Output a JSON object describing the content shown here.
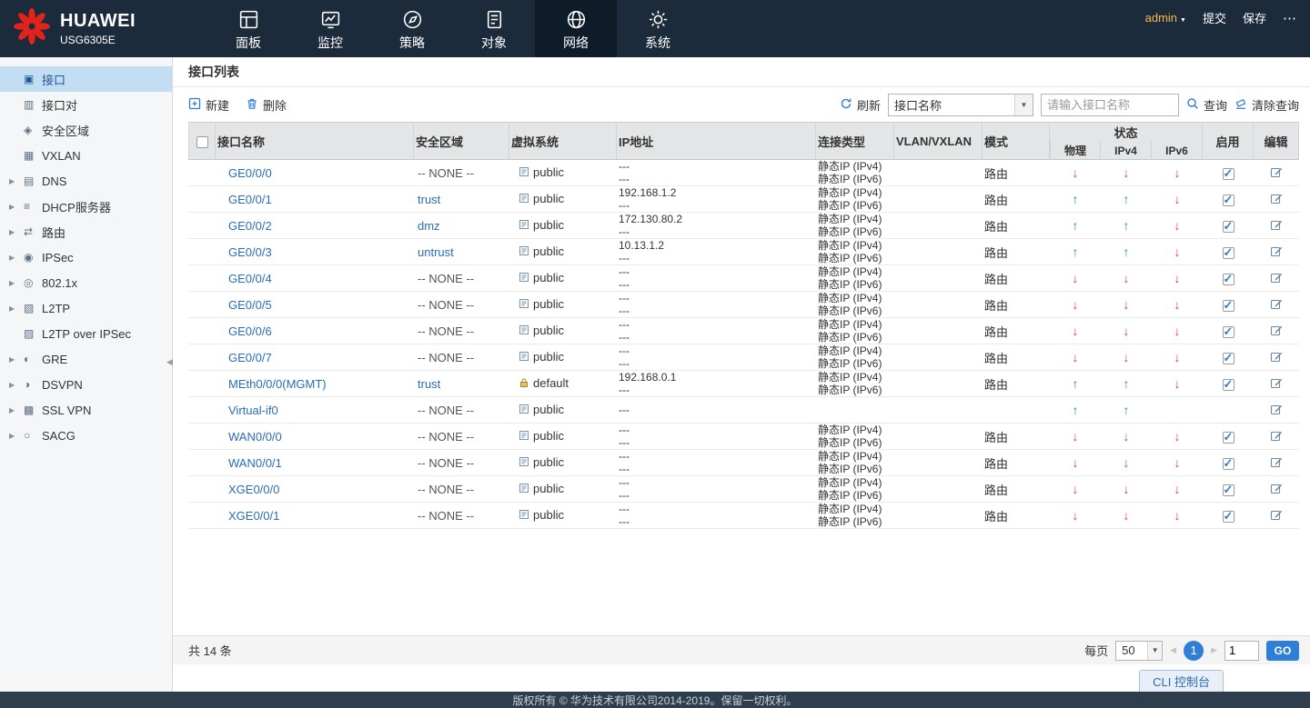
{
  "colors": {
    "accent": "#2f7ed8",
    "brand_red": "#e2231a",
    "status_up": "#2ca24c",
    "status_down": "#e04444",
    "topbar_bg": "#1c2b3c",
    "sidebar_selected_bg": "#c3ddf3"
  },
  "app": {
    "brand": "HUAWEI",
    "model": "USG6305E",
    "user": "admin",
    "actions": {
      "commit": "提交",
      "save": "保存",
      "more": "⋯"
    }
  },
  "nav": [
    {
      "id": "dashboard",
      "label": "面板",
      "icon": "dashboard-icon",
      "active": false
    },
    {
      "id": "monitor",
      "label": "监控",
      "icon": "monitor-icon",
      "active": false
    },
    {
      "id": "policy",
      "label": "策略",
      "icon": "policy-icon",
      "active": false
    },
    {
      "id": "object",
      "label": "对象",
      "icon": "object-icon",
      "active": false
    },
    {
      "id": "network",
      "label": "网络",
      "icon": "network-icon",
      "active": true
    },
    {
      "id": "system",
      "label": "系统",
      "icon": "system-icon",
      "active": false
    }
  ],
  "sidebar": [
    {
      "id": "interface",
      "label": "接口",
      "icon": "interface-icon",
      "active": true,
      "expandable": false
    },
    {
      "id": "interface-pair",
      "label": "接口对",
      "icon": "interface-pair-icon",
      "active": false,
      "expandable": false
    },
    {
      "id": "security-zone",
      "label": "安全区域",
      "icon": "security-zone-icon",
      "active": false,
      "expandable": false
    },
    {
      "id": "vxlan",
      "label": "VXLAN",
      "icon": "vxlan-icon",
      "active": false,
      "expandable": false
    },
    {
      "id": "dns",
      "label": "DNS",
      "icon": "dns-icon",
      "active": false,
      "expandable": true
    },
    {
      "id": "dhcp-server",
      "label": "DHCP服务器",
      "icon": "dhcp-icon",
      "active": false,
      "expandable": true
    },
    {
      "id": "route",
      "label": "路由",
      "icon": "route-icon",
      "active": false,
      "expandable": true
    },
    {
      "id": "ipsec",
      "label": "IPSec",
      "icon": "ipsec-icon",
      "active": false,
      "expandable": true
    },
    {
      "id": "dot1x",
      "label": "802.1x",
      "icon": "dot1x-icon",
      "active": false,
      "expandable": true
    },
    {
      "id": "l2tp",
      "label": "L2TP",
      "icon": "l2tp-icon",
      "active": false,
      "expandable": true
    },
    {
      "id": "l2tp-over-ipsec",
      "label": "L2TP over IPSec",
      "icon": "l2tp-ipsec-icon",
      "active": false,
      "expandable": false
    },
    {
      "id": "gre",
      "label": "GRE",
      "icon": "gre-icon",
      "active": false,
      "expandable": true
    },
    {
      "id": "dsvpn",
      "label": "DSVPN",
      "icon": "dsvpn-icon",
      "active": false,
      "expandable": true
    },
    {
      "id": "ssl-vpn",
      "label": "SSL VPN",
      "icon": "sslvpn-icon",
      "active": false,
      "expandable": true
    },
    {
      "id": "sacg",
      "label": "SACG",
      "icon": "sacg-icon",
      "active": false,
      "expandable": true
    }
  ],
  "page": {
    "title": "接口列表",
    "toolbar": {
      "new": "新建",
      "delete": "删除",
      "refresh": "刷新",
      "filter_selected": "接口名称",
      "search_placeholder": "请输入接口名称",
      "query": "查询",
      "clear_query": "清除查询"
    },
    "table": {
      "headers": {
        "name": "接口名称",
        "zone": "安全区域",
        "vsys": "虚拟系统",
        "ip": "IP地址",
        "conn": "连接类型",
        "vlan": "VLAN/VXLAN",
        "mode": "模式",
        "status": "状态",
        "phy": "物理",
        "ipv4": "IPv4",
        "ipv6": "IPv6",
        "enable": "启用",
        "edit": "编辑"
      },
      "rows": [
        {
          "name": "GE0/0/0",
          "zone": "-- NONE --",
          "zone_is_link": false,
          "vsys": "public",
          "vsys_icon": "vsys-doc-icon",
          "ip": [
            "---",
            "---"
          ],
          "conn": [
            "静态IP (IPv4)",
            "静态IP (IPv6)"
          ],
          "vlan": "",
          "mode": "路由",
          "status": {
            "phy": "down",
            "ipv4": "down",
            "ipv6": "down"
          },
          "enabled": true
        },
        {
          "name": "GE0/0/1",
          "zone": "trust",
          "zone_is_link": true,
          "vsys": "public",
          "vsys_icon": "vsys-doc-icon",
          "ip": [
            "192.168.1.2",
            "---"
          ],
          "conn": [
            "静态IP (IPv4)",
            "静态IP (IPv6)"
          ],
          "vlan": "",
          "mode": "路由",
          "status": {
            "phy": "up",
            "ipv4": "up",
            "ipv6": "down"
          },
          "enabled": true
        },
        {
          "name": "GE0/0/2",
          "zone": "dmz",
          "zone_is_link": true,
          "vsys": "public",
          "vsys_icon": "vsys-doc-icon",
          "ip": [
            "172.130.80.2",
            "---"
          ],
          "conn": [
            "静态IP (IPv4)",
            "静态IP (IPv6)"
          ],
          "vlan": "",
          "mode": "路由",
          "status": {
            "phy": "up",
            "ipv4": "up",
            "ipv6": "down"
          },
          "enabled": true
        },
        {
          "name": "GE0/0/3",
          "zone": "untrust",
          "zone_is_link": true,
          "vsys": "public",
          "vsys_icon": "vsys-doc-icon",
          "ip": [
            "10.13.1.2",
            "---"
          ],
          "conn": [
            "静态IP (IPv4)",
            "静态IP (IPv6)"
          ],
          "vlan": "",
          "mode": "路由",
          "status": {
            "phy": "up",
            "ipv4": "up",
            "ipv6": "down"
          },
          "enabled": true
        },
        {
          "name": "GE0/0/4",
          "zone": "-- NONE --",
          "zone_is_link": false,
          "vsys": "public",
          "vsys_icon": "vsys-doc-icon",
          "ip": [
            "---",
            "---"
          ],
          "conn": [
            "静态IP (IPv4)",
            "静态IP (IPv6)"
          ],
          "vlan": "",
          "mode": "路由",
          "status": {
            "phy": "down",
            "ipv4": "down",
            "ipv6": "down"
          },
          "enabled": true
        },
        {
          "name": "GE0/0/5",
          "zone": "-- NONE --",
          "zone_is_link": false,
          "vsys": "public",
          "vsys_icon": "vsys-doc-icon",
          "ip": [
            "---",
            "---"
          ],
          "conn": [
            "静态IP (IPv4)",
            "静态IP (IPv6)"
          ],
          "vlan": "",
          "mode": "路由",
          "status": {
            "phy": "down",
            "ipv4": "down",
            "ipv6": "down"
          },
          "enabled": true
        },
        {
          "name": "GE0/0/6",
          "zone": "-- NONE --",
          "zone_is_link": false,
          "vsys": "public",
          "vsys_icon": "vsys-doc-icon",
          "ip": [
            "---",
            "---"
          ],
          "conn": [
            "静态IP (IPv4)",
            "静态IP (IPv6)"
          ],
          "vlan": "",
          "mode": "路由",
          "status": {
            "phy": "down",
            "ipv4": "down",
            "ipv6": "down"
          },
          "enabled": true
        },
        {
          "name": "GE0/0/7",
          "zone": "-- NONE --",
          "zone_is_link": false,
          "vsys": "public",
          "vsys_icon": "vsys-doc-icon",
          "ip": [
            "---",
            "---"
          ],
          "conn": [
            "静态IP (IPv4)",
            "静态IP (IPv6)"
          ],
          "vlan": "",
          "mode": "路由",
          "status": {
            "phy": "down",
            "ipv4": "down",
            "ipv6": "down"
          },
          "enabled": true
        },
        {
          "name": "MEth0/0/0(MGMT)",
          "zone": "trust",
          "zone_is_link": true,
          "vsys": "default",
          "vsys_icon": "lock-icon",
          "ip": [
            "192.168.0.1",
            "---"
          ],
          "conn": [
            "静态IP (IPv4)",
            "静态IP (IPv6)"
          ],
          "vlan": "",
          "mode": "路由",
          "status": {
            "phy": "up",
            "ipv4": "up",
            "ipv6": "down"
          },
          "enabled": true
        },
        {
          "name": "Virtual-if0",
          "zone": "-- NONE --",
          "zone_is_link": false,
          "vsys": "public",
          "vsys_icon": "vsys-doc-icon",
          "ip": [
            "---"
          ],
          "conn": [],
          "vlan": "",
          "mode": "",
          "status": {
            "phy": "up",
            "ipv4": "up",
            "ipv6": ""
          },
          "enabled": false
        },
        {
          "name": "WAN0/0/0",
          "zone": "-- NONE --",
          "zone_is_link": false,
          "vsys": "public",
          "vsys_icon": "vsys-doc-icon",
          "ip": [
            "---",
            "---"
          ],
          "conn": [
            "静态IP (IPv4)",
            "静态IP (IPv6)"
          ],
          "vlan": "",
          "mode": "路由",
          "status": {
            "phy": "down",
            "ipv4": "down",
            "ipv6": "down"
          },
          "enabled": true
        },
        {
          "name": "WAN0/0/1",
          "zone": "-- NONE --",
          "zone_is_link": false,
          "vsys": "public",
          "vsys_icon": "vsys-doc-icon",
          "ip": [
            "---",
            "---"
          ],
          "conn": [
            "静态IP (IPv4)",
            "静态IP (IPv6)"
          ],
          "vlan": "",
          "mode": "路由",
          "status": {
            "phy": "down",
            "ipv4": "down",
            "ipv6": "down"
          },
          "enabled": true
        },
        {
          "name": "XGE0/0/0",
          "zone": "-- NONE --",
          "zone_is_link": false,
          "vsys": "public",
          "vsys_icon": "vsys-doc-icon",
          "ip": [
            "---",
            "---"
          ],
          "conn": [
            "静态IP (IPv4)",
            "静态IP (IPv6)"
          ],
          "vlan": "",
          "mode": "路由",
          "status": {
            "phy": "down",
            "ipv4": "down",
            "ipv6": "down"
          },
          "enabled": true
        },
        {
          "name": "XGE0/0/1",
          "zone": "-- NONE --",
          "zone_is_link": false,
          "vsys": "public",
          "vsys_icon": "vsys-doc-icon",
          "ip": [
            "---",
            "---"
          ],
          "conn": [
            "静态IP (IPv4)",
            "静态IP (IPv6)"
          ],
          "vlan": "",
          "mode": "路由",
          "status": {
            "phy": "down",
            "ipv4": "down",
            "ipv6": "down"
          },
          "enabled": true
        }
      ]
    },
    "pagination": {
      "total": "共 14 条",
      "per_page_label": "每页",
      "per_page": "50",
      "current_page": "1",
      "page_input": "1",
      "go": "GO"
    }
  },
  "footer": {
    "cli": "CLI 控制台",
    "copyright": "版权所有 © 华为技术有限公司2014-2019。保留一切权利。"
  }
}
